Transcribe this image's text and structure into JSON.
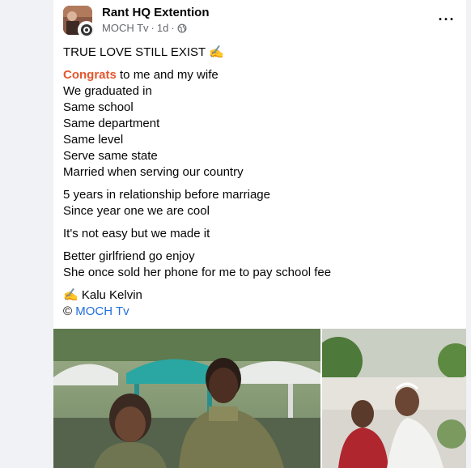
{
  "post": {
    "page_name": "Rant HQ Extention",
    "source": "MOCH Tv",
    "time": "1d",
    "more_label": "···",
    "title_line": "TRUE LOVE STILL EXIST ✍",
    "congrats_word": "Congrats",
    "congrats_rest": " to me and my wife",
    "block1": [
      "We graduated in",
      "Same school",
      "Same department",
      "Same level",
      "Serve same state",
      "Married when serving our country"
    ],
    "block2": [
      "5 years in relationship before marriage",
      "Since year one we are cool"
    ],
    "block3": [
      "It's not easy but we made it"
    ],
    "block4": [
      "Better girlfriend go enjoy",
      "She once sold her phone for me to pay school fee"
    ],
    "author": "✍ Kalu Kelvin",
    "copyright_symbol": "© ",
    "copyright_link": "MOCH Tv"
  },
  "colors": {
    "accent_link": "#216fdb",
    "highlight": "#e4572e",
    "meta": "#65676b"
  },
  "icons": [
    "globe-icon",
    "more-options-icon",
    "avatar-logo"
  ]
}
